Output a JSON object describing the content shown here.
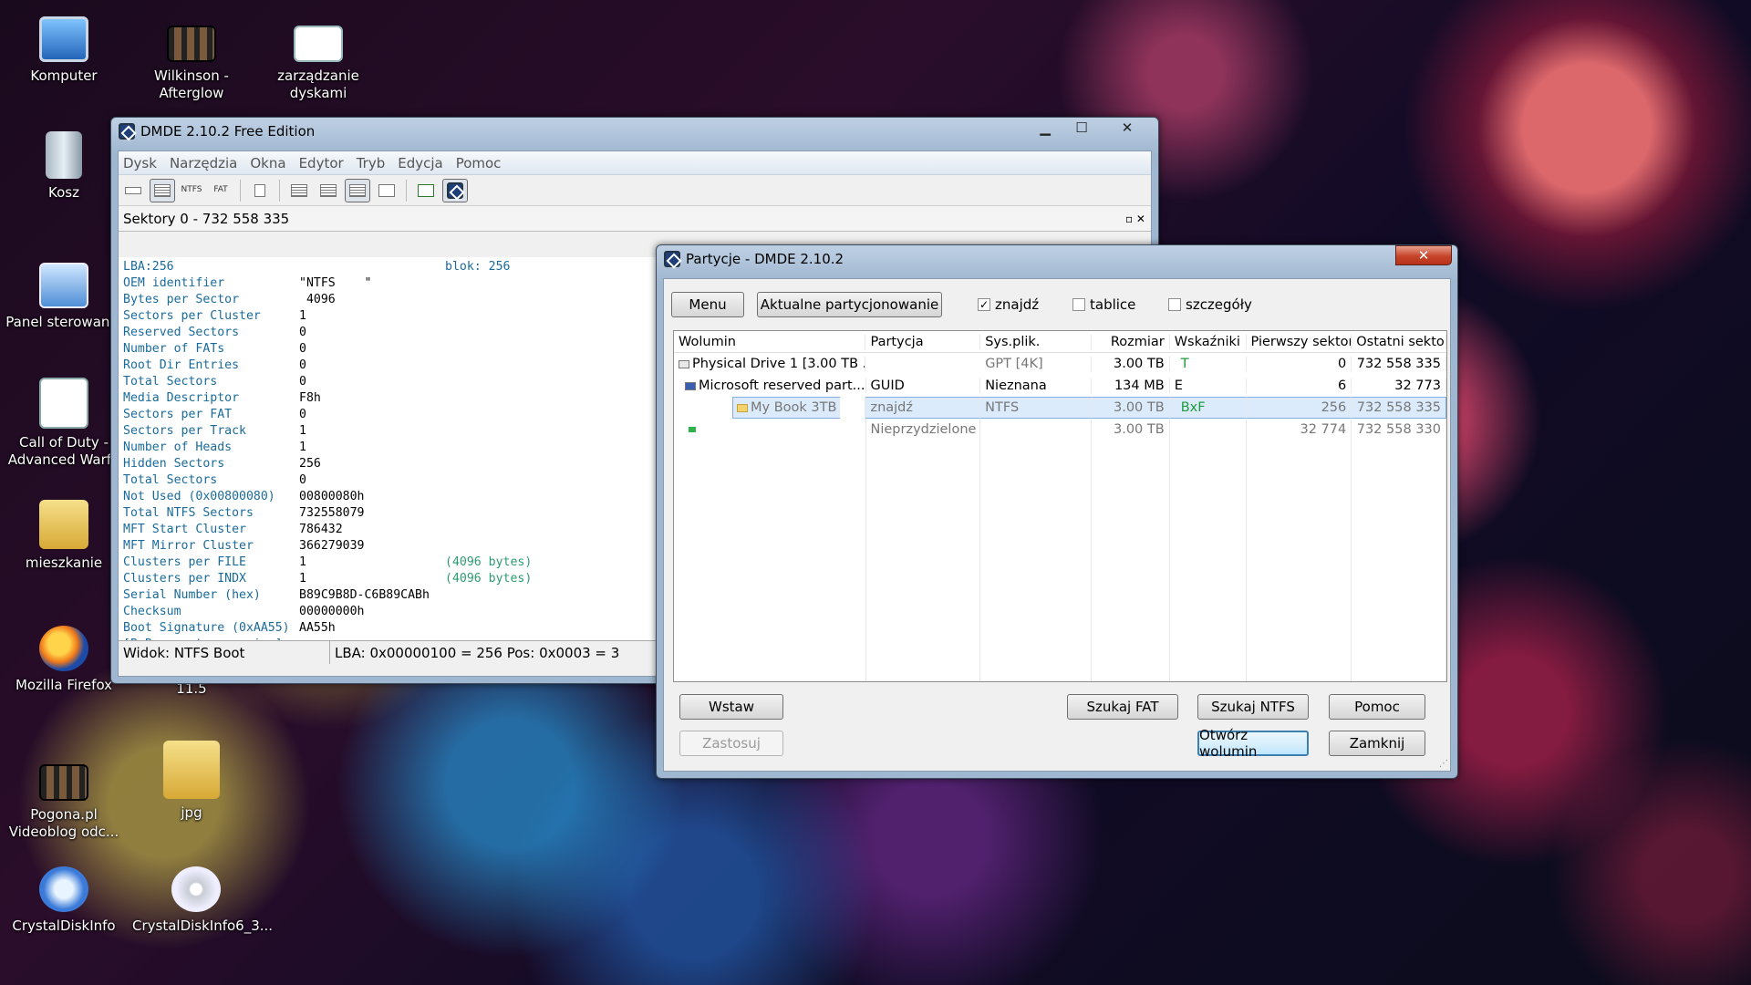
{
  "desktop": {
    "icons": [
      {
        "label": "Komputer",
        "icon": "computer-icon"
      },
      {
        "label": "Wilkinson -\nAfterglow",
        "icon": "video-file-icon"
      },
      {
        "label": "zarządzanie\ndyskami",
        "icon": "shortcut-doc-icon"
      },
      {
        "label": "Kosz",
        "icon": "recycle-bin-icon"
      },
      {
        "label": "Panel sterowania",
        "icon": "control-panel-icon"
      },
      {
        "label": "Call of Duty -\nAdvanced Warfa",
        "icon": "game-shortcut-icon"
      },
      {
        "label": "mieszkanie",
        "icon": "folder-icon"
      },
      {
        "label": "Mozilla Firefox",
        "icon": "firefox-icon"
      },
      {
        "label": "11.5",
        "icon": ""
      },
      {
        "label": "Pogona.pl\nVideoblog odc...",
        "icon": "video-file-icon"
      },
      {
        "label": "jpg",
        "icon": "folder-icon"
      },
      {
        "label": "CrystalDiskInfo",
        "icon": "crystaldiskinfo-icon"
      },
      {
        "label": "CrystalDiskInfo6_3...",
        "icon": "disc-image-icon"
      }
    ]
  },
  "dmde": {
    "title": "DMDE 2.10.2 Free Edition",
    "menu": [
      "Dysk",
      "Narzędzia",
      "Okna",
      "Edytor",
      "Tryb",
      "Edycja",
      "Pomoc"
    ],
    "toolbar": {
      "ntfs": "NTFS",
      "fat": "FAT"
    },
    "subtitle": "Sektory 0 - 732 558 335",
    "subtitle_ctrls": "▫ ✕",
    "rows": [
      {
        "k": "LBA:256",
        "v": "",
        "n": "blok: 256",
        "s": ""
      },
      {
        "k": "OEM identifier",
        "v": "\"NTFS    \"",
        "n": "",
        "s": ""
      },
      {
        "k": "Bytes per Sector",
        "v": " 4096",
        "n": "",
        "s": ""
      },
      {
        "k": "Sectors per Cluster",
        "v": "1",
        "n": "",
        "s": ""
      },
      {
        "k": "Reserved Sectors",
        "v": "0",
        "n": "",
        "s": ""
      },
      {
        "k": "Number of FATs",
        "v": "0",
        "n": "",
        "s": ""
      },
      {
        "k": "Root Dir Entries",
        "v": "0",
        "n": "",
        "s": ""
      },
      {
        "k": "Total Sectors",
        "v": "0",
        "n": "",
        "s": ""
      },
      {
        "k": "Media Descriptor",
        "v": "F8",
        "n": "",
        "s": "h"
      },
      {
        "k": "Sectors per FAT",
        "v": "0",
        "n": "",
        "s": ""
      },
      {
        "k": "Sectors per Track",
        "v": "1",
        "n": "",
        "s": ""
      },
      {
        "k": "Number of Heads",
        "v": "1",
        "n": "",
        "s": ""
      },
      {
        "k": "Hidden Sectors",
        "v": "256",
        "n": "",
        "s": ""
      },
      {
        "k": "Total Sectors",
        "v": "0",
        "n": "",
        "s": ""
      },
      {
        "k": "Not Used (0x00800080)",
        "v": "00800080",
        "n": "",
        "s": "h"
      },
      {
        "k": "Total NTFS Sectors",
        "v": "732558079",
        "n": "",
        "s": ""
      },
      {
        "k": "MFT Start Cluster",
        "v": "786432",
        "n": "",
        "s": ""
      },
      {
        "k": "MFT Mirror Cluster",
        "v": "366279039",
        "n": "",
        "s": ""
      },
      {
        "k": "Clusters per FILE",
        "v": "1",
        "n": "(4096 bytes)",
        "s": ""
      },
      {
        "k": "Clusters per INDX",
        "v": "1",
        "n": "(4096 bytes)",
        "s": ""
      },
      {
        "k": "Serial Number (hex)",
        "v": "B89C9B8D-C6B89CAB",
        "n": "",
        "s": "h"
      },
      {
        "k": "Checksum",
        "v": "00000000",
        "n": "",
        "s": "h"
      },
      {
        "k": "Boot Signature (0xAA55)",
        "v": "AA55",
        "n": "",
        "s": "h"
      },
      {
        "k": "[BxBx: sectory zapisu]",
        "v": "",
        "n": "",
        "s": ""
      }
    ],
    "status_left": "Widok: NTFS Boot",
    "status_right": "LBA: 0x00000100 = 256  Pos: 0x0003 = 3"
  },
  "partitions": {
    "title": "Partycje - DMDE 2.10.2",
    "btn_menu": "Menu",
    "btn_current": "Aktualne partycjonowanie",
    "chk_found": "znajdź",
    "chk_found_mark": "✓",
    "chk_tables": "tablice",
    "chk_details": "szczegóły",
    "columns": [
      "Wolumin",
      "Partycja",
      "Sys.plik.",
      "Rozmiar",
      "Wskaźniki",
      "Pierwszy sektor",
      "Ostatni sektor"
    ],
    "rows": [
      {
        "vol": "Physical Drive 1 [3.00 TB ...",
        "part": "",
        "fs": "GPT [4K]",
        "size": "3.00 TB",
        "flags": "T",
        "first": "0",
        "last": "732 558 335"
      },
      {
        "vol": "Microsoft reserved part...",
        "part": "GUID",
        "fs": "Nieznana",
        "size": "134 MB",
        "flags": "E",
        "first": "6",
        "last": "32 773"
      },
      {
        "vol": "My Book 3TB",
        "part": "znajdź",
        "fs": "NTFS",
        "size": "3.00 TB",
        "flags": "BxF",
        "first": "256",
        "last": "732 558 335"
      },
      {
        "vol": "",
        "part": "Nieprzydzielone",
        "fs": "",
        "size": "3.00 TB",
        "flags": "",
        "first": "32 774",
        "last": "732 558 330"
      }
    ],
    "btn_insert": "Wstaw",
    "btn_apply": "Zastosuj",
    "btn_search_fat": "Szukaj FAT",
    "btn_search_ntfs": "Szukaj NTFS",
    "btn_help": "Pomoc",
    "btn_open": "Otwórz wolumin",
    "btn_close": "Zamknij"
  },
  "window_controls": {
    "min": "▁",
    "max": "☐",
    "close": "✕"
  }
}
